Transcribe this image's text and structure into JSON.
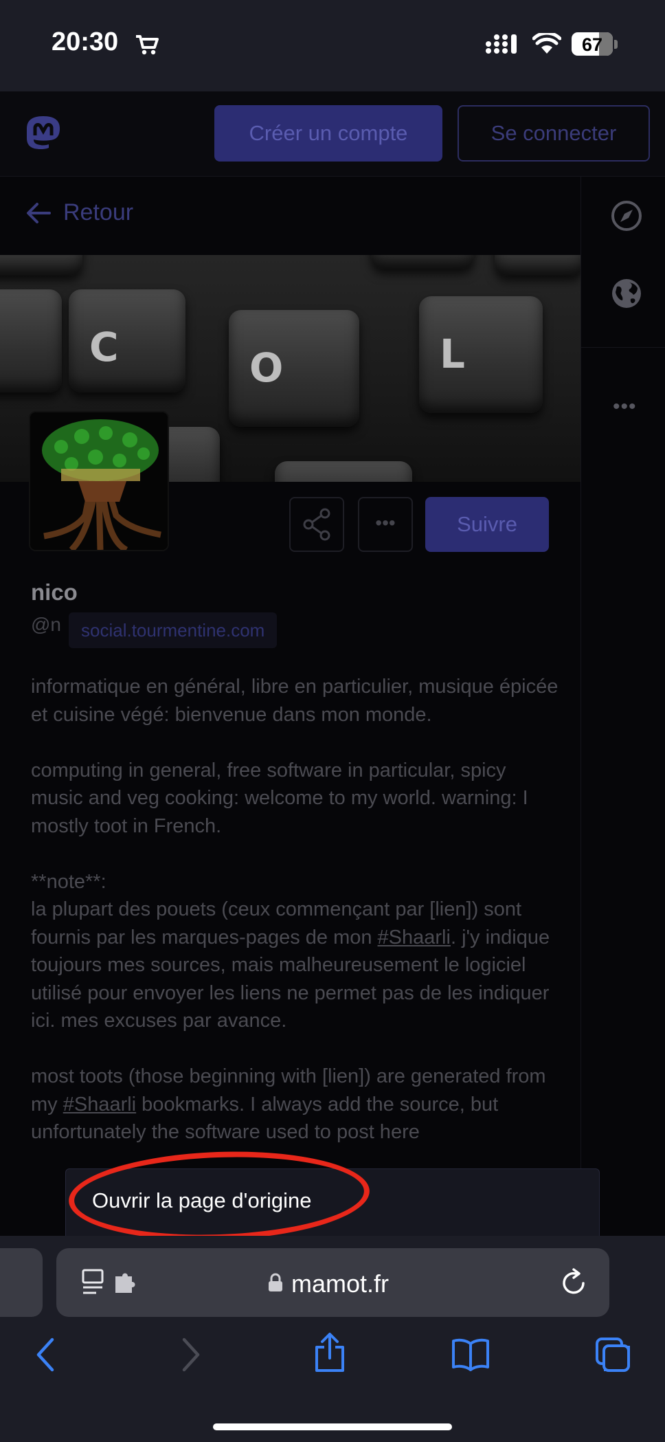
{
  "status_bar": {
    "time": "20:30",
    "battery": "67"
  },
  "header": {
    "create_account": "Créer un compte",
    "sign_in": "Se connecter"
  },
  "nav": {
    "back": "Retour"
  },
  "banner": {
    "keys": [
      "C",
      "O",
      "L"
    ]
  },
  "profile": {
    "name": "nico",
    "handle": "@n",
    "domain": "social.tourmentine.com",
    "follow": "Suivre",
    "more": "•••"
  },
  "bio": {
    "p1": "informatique en général, libre en particulier, musique épicée et cuisine végé: bienvenue dans mon monde.",
    "p2": "computing in general, free software in particular, spicy music and veg cooking: welcome to my world. warning: I mostly toot in French.",
    "p3_heading": "**note**:",
    "p3_before": "la plupart des pouets (ceux commençant par [lien]) sont fournis par les marques-pages de mon ",
    "p3_tag": "#Shaarli",
    "p3_after": ". j'y indique toujours mes sources, mais malheureusement le logiciel utilisé pour envoyer les liens ne permet pas de les indiquer ici. mes excuses par avance.",
    "p4_before": "most toots (those beginning with [lien]) are generated from my ",
    "p4_tag": "#Shaarli",
    "p4_after": " bookmarks. I always add the source, but unfortunately the software used to post here"
  },
  "sidebar": {
    "more": "•••"
  },
  "context_menu": {
    "open_original": "Ouvrir la page d'origine"
  },
  "browser": {
    "url": "mamot.fr"
  },
  "colors": {
    "accent": "#2c2d73",
    "annotation_ring": "#e8271a",
    "ios_blue": "#3b82f6"
  }
}
